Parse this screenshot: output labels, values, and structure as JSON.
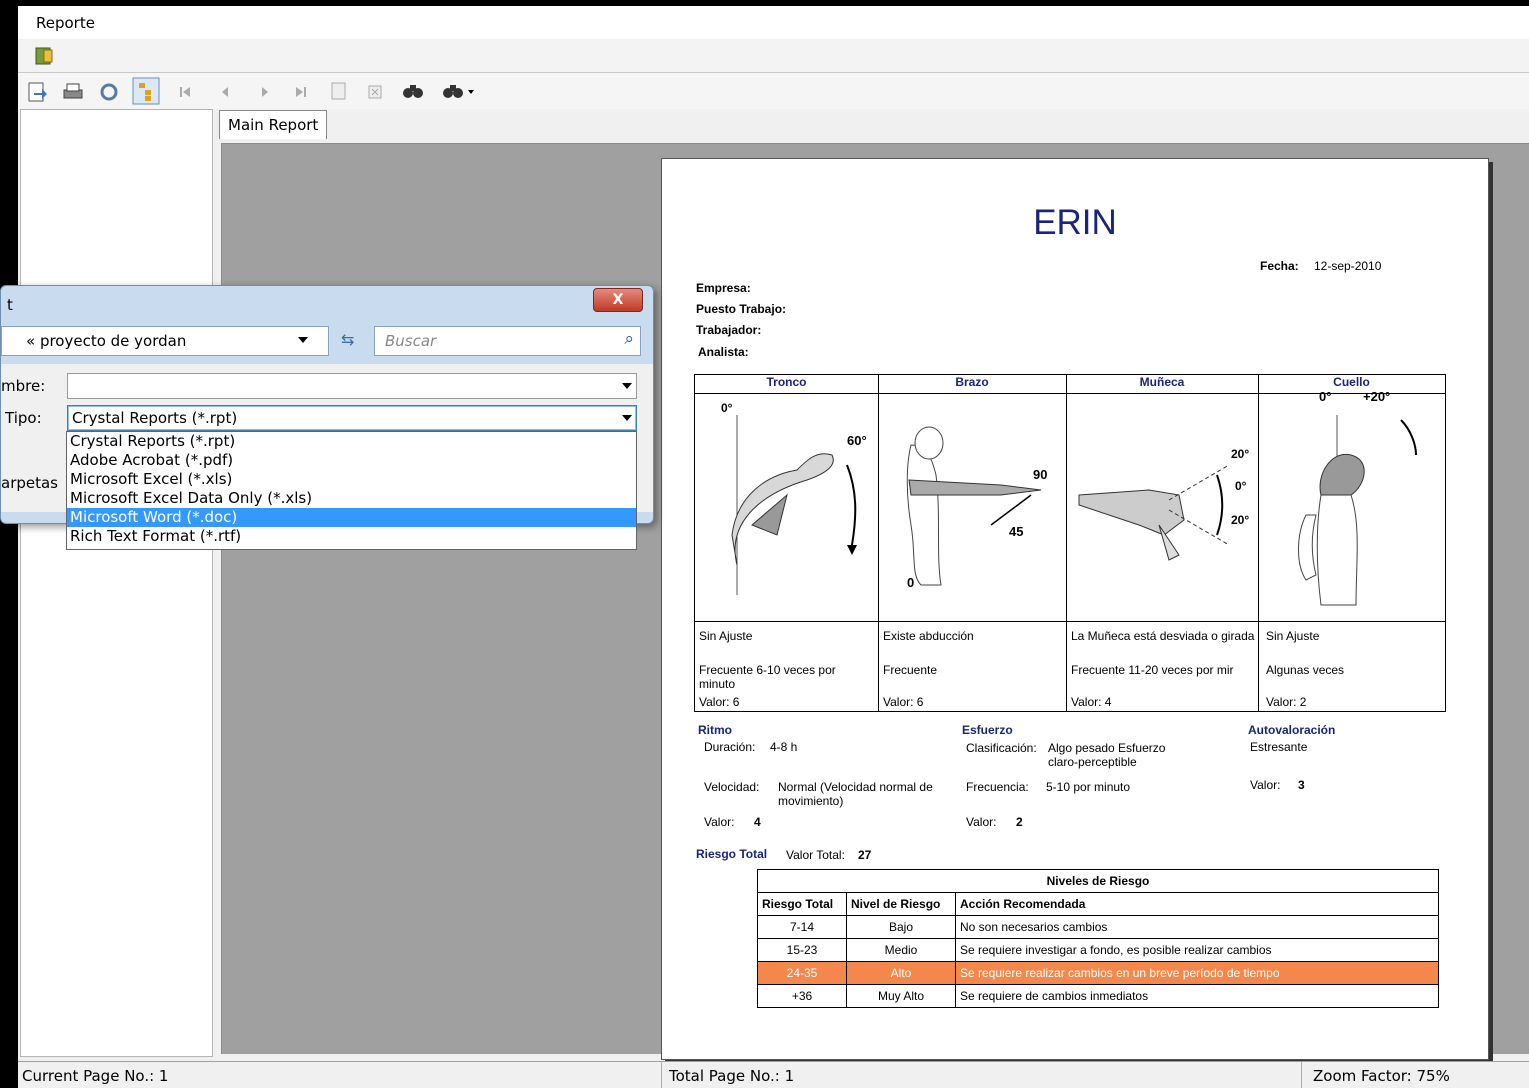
{
  "menu": {
    "reporte": "Reporte"
  },
  "tab": {
    "main_report": "Main Report"
  },
  "status": {
    "current_page": "Current Page No.: 1",
    "total_page": "Total Page No.: 1",
    "zoom": "Zoom Factor: 75%"
  },
  "report": {
    "title": "ERIN",
    "fecha_label": "Fecha:",
    "fecha_value": "12-sep-2010",
    "empresa": "Empresa:",
    "puesto": "Puesto Trabajo:",
    "trabajador": "Trabajador:",
    "analista": "Analista:",
    "columns": [
      {
        "header": "Tronco",
        "ajuste": "Sin Ajuste",
        "frecuencia": "Frecuente 6-10 veces por minuto",
        "valor": "Valor: 6"
      },
      {
        "header": "Brazo",
        "ajuste": "Existe abducción",
        "frecuencia": "Frecuente",
        "valor": "Valor: 6"
      },
      {
        "header": "Muñeca",
        "ajuste": "La Muñeca está desviada o girada",
        "frecuencia": "Frecuente 11-20 veces por mir",
        "valor": "Valor: 4"
      },
      {
        "header": "Cuello",
        "ajuste": "Sin Ajuste",
        "frecuencia": "Algunas veces",
        "valor": "Valor: 2"
      }
    ],
    "fig_labels": {
      "tronco_0": "0°",
      "tronco_60": "60°",
      "brazo_90": "90",
      "brazo_45": "45",
      "brazo_0": "0",
      "muneca_20a": "20°",
      "muneca_0": "0°",
      "muneca_20b": "20°",
      "cuello_0": "0°",
      "cuello_20": "+20°"
    },
    "ritmo": {
      "title": "Ritmo",
      "duracion_label": "Duración:",
      "duracion": "4-8 h",
      "velocidad_label": "Velocidad:",
      "velocidad": "Normal (Velocidad normal de movimiento)",
      "valor_label": "Valor:",
      "valor": "4"
    },
    "esfuerzo": {
      "title": "Esfuerzo",
      "clasif_label": "Clasificación:",
      "clasif": "Algo pesado Esfuerzo claro-perceptible",
      "frec_label": "Frecuencia:",
      "frec": "5-10 por minuto",
      "valor_label": "Valor:",
      "valor": "2"
    },
    "autoval": {
      "title": "Autovaloración",
      "text": "Estresante",
      "valor_label": "Valor:",
      "valor": "3"
    },
    "riesgo": {
      "title": "Riesgo Total",
      "valor_total_label": "Valor Total:",
      "valor_total": "27"
    },
    "niveles": {
      "title": "Niveles de Riesgo",
      "headers": [
        "Riesgo Total",
        "Nivel de Riesgo",
        "Acción Recomendada"
      ],
      "rows": [
        [
          "7-14",
          "Bajo",
          "No son necesarios cambios"
        ],
        [
          "15-23",
          "Medio",
          "Se requiere investigar a fondo, es posible realizar cambios"
        ],
        [
          "24-35",
          "Alto",
          "Se requiere realizar cambios en un breve período de tiempo"
        ],
        [
          "+36",
          "Muy Alto",
          "Se requiere de cambios inmediatos"
        ]
      ]
    }
  },
  "dialog": {
    "title": "t",
    "close": "X",
    "address": "« proyecto de yordan",
    "search_placeholder": "Buscar",
    "nombre_label": "mbre:",
    "tipo_label": "Tipo:",
    "tipo_value": "Crystal Reports (*.rpt)",
    "carpetas_label": "arpetas",
    "options": [
      "Crystal Reports (*.rpt)",
      "Adobe Acrobat (*.pdf)",
      "Microsoft Excel (*.xls)",
      "Microsoft Excel Data Only (*.xls)",
      "Microsoft Word (*.doc)",
      "Rich Text Format (*.rtf)"
    ],
    "selected_index": 4
  },
  "colors": {
    "accent_blue": "#1a237e",
    "highlight_orange": "#f4874b",
    "selection_blue": "#3399ff"
  }
}
